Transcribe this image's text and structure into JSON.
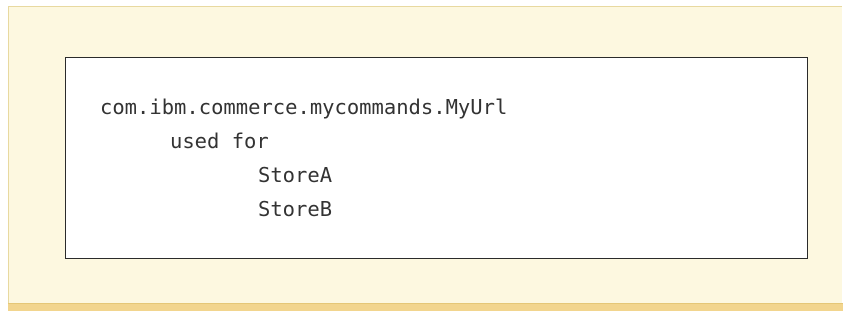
{
  "code": {
    "class_name": "com.ibm.commerce.mycommands.MyUrl",
    "relation": "used for",
    "stores": [
      "StoreA",
      "StoreB"
    ]
  },
  "colors": {
    "panel_background": "#fdf8e0",
    "panel_bottom_border": "#f2d58e",
    "code_box_border": "#2b2b2b",
    "text": "#333333"
  }
}
